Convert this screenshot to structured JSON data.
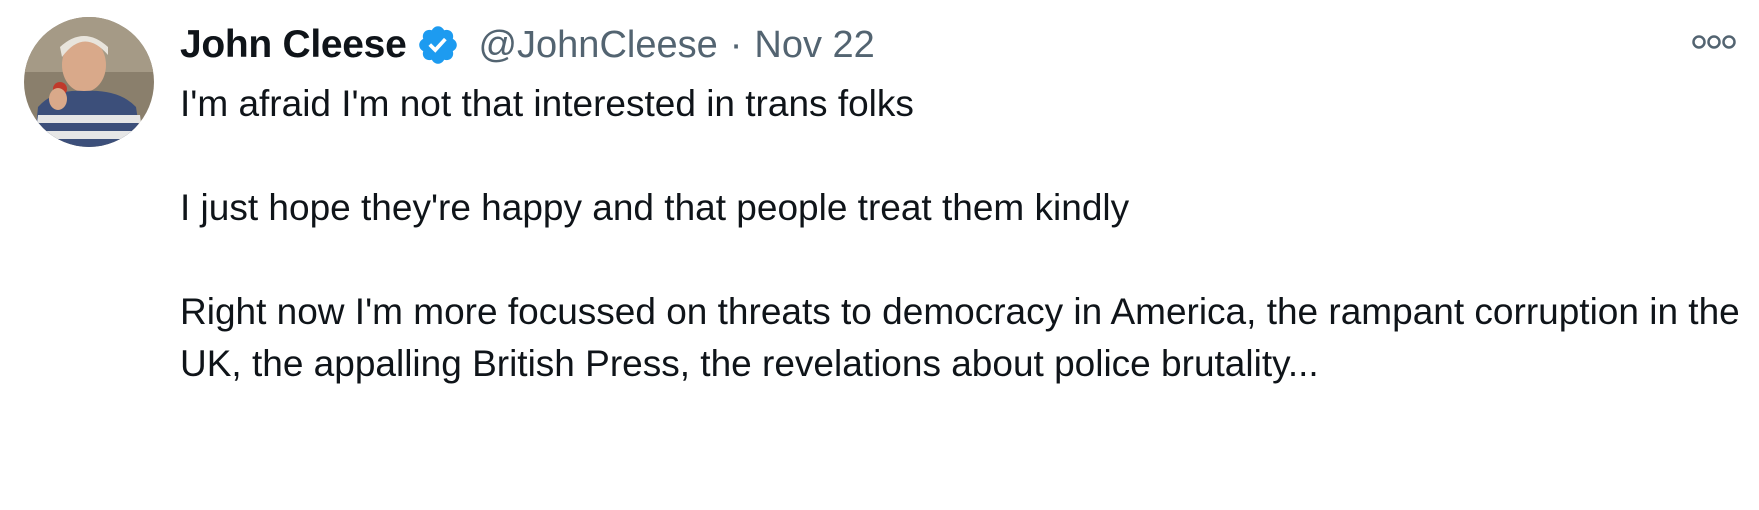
{
  "tweet": {
    "display_name": "John Cleese",
    "handle": "@JohnCleese",
    "separator": "·",
    "date": "Nov 22",
    "avatar_icon": "profile-photo",
    "verified_icon": "verified-badge-icon",
    "more_icon": "more-options-icon",
    "accent_color": "#1d9bf0",
    "paragraphs": [
      "I'm afraid I'm not that interested in trans folks",
      "I just hope they're happy and that people treat them kindly",
      "Right now I'm more focussed on threats to democracy in America, the rampant corruption in the UK, the appalling British Press, the revelations about police brutality..."
    ]
  }
}
